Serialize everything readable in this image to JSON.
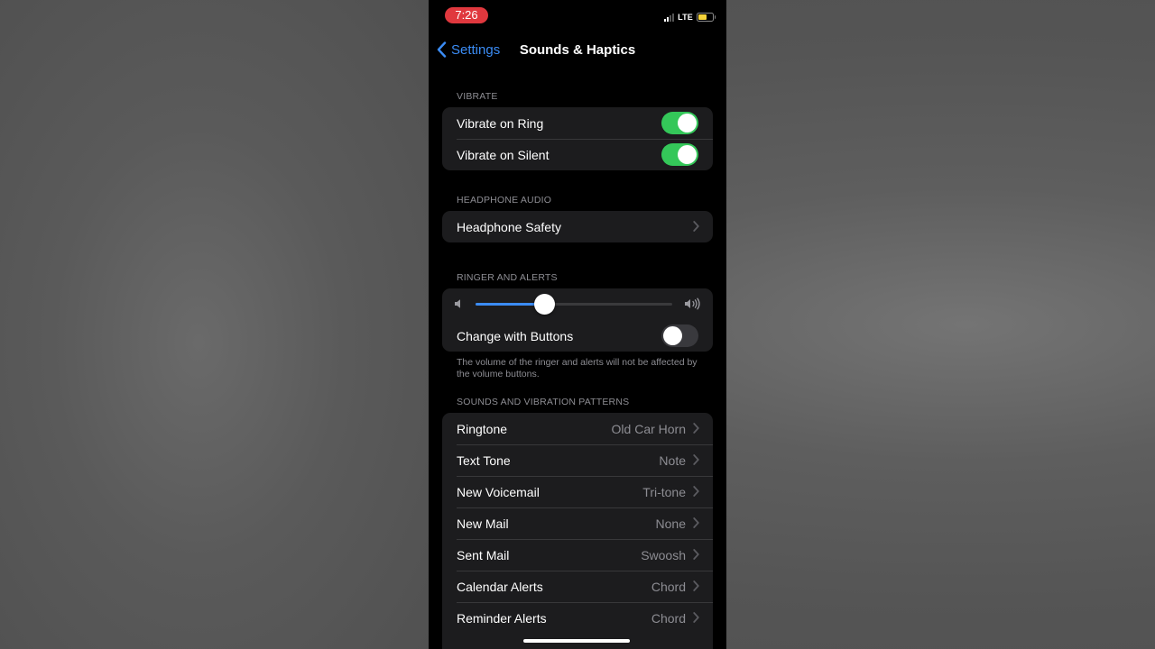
{
  "status_bar": {
    "time": "7:26",
    "network": "LTE",
    "battery_color": "#f5d33a"
  },
  "nav": {
    "back_label": "Settings",
    "title": "Sounds & Haptics"
  },
  "vibrate": {
    "header": "VIBRATE",
    "rows": [
      {
        "label": "Vibrate on Ring",
        "on": true
      },
      {
        "label": "Vibrate on Silent",
        "on": true
      }
    ]
  },
  "headphone": {
    "header": "HEADPHONE AUDIO",
    "rows": [
      {
        "label": "Headphone Safety"
      }
    ]
  },
  "ringer": {
    "header": "RINGER AND ALERTS",
    "volume_level": 0.35,
    "change_with_buttons": {
      "label": "Change with Buttons",
      "on": false
    },
    "footer": "The volume of the ringer and alerts will not be affected by the volume buttons."
  },
  "patterns": {
    "header": "SOUNDS AND VIBRATION PATTERNS",
    "rows": [
      {
        "label": "Ringtone",
        "value": "Old Car Horn"
      },
      {
        "label": "Text Tone",
        "value": "Note"
      },
      {
        "label": "New Voicemail",
        "value": "Tri-tone"
      },
      {
        "label": "New Mail",
        "value": "None"
      },
      {
        "label": "Sent Mail",
        "value": "Swoosh"
      },
      {
        "label": "Calendar Alerts",
        "value": "Chord"
      },
      {
        "label": "Reminder Alerts",
        "value": "Chord"
      }
    ]
  },
  "colors": {
    "accent": "#3b8cf5",
    "toggle_on": "#34c759",
    "cell": "#1c1c1e"
  }
}
